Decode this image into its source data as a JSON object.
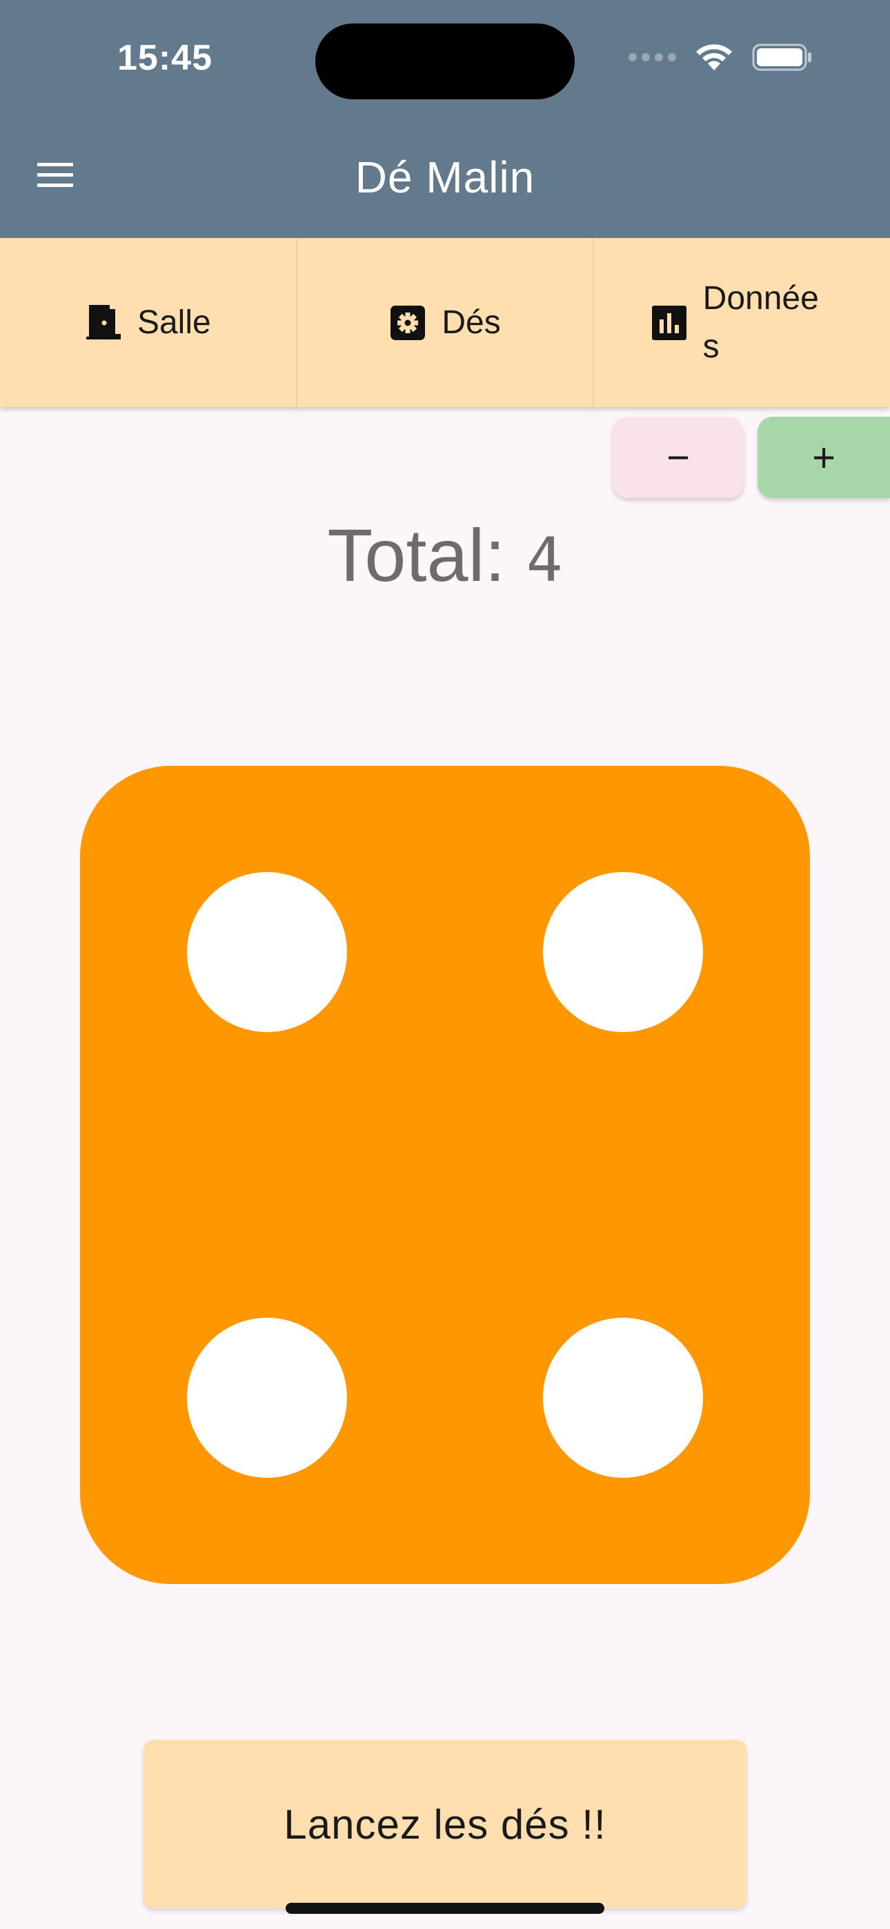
{
  "status_bar": {
    "time": "15:45"
  },
  "app_bar": {
    "title": "Dé Malin",
    "menu_icon": "menu-icon"
  },
  "tabs": [
    {
      "label": "Salle",
      "icon": "door-icon"
    },
    {
      "label": "Dés",
      "icon": "dice-icon"
    },
    {
      "label": "Données",
      "icon": "bar-chart-icon"
    }
  ],
  "stepper": {
    "minus_label": "−",
    "plus_label": "+"
  },
  "total": {
    "label": "Total:",
    "value": "4"
  },
  "die": {
    "face_value": 4,
    "color": "#FF9700",
    "pip_color": "#FFFFFF"
  },
  "roll_button": {
    "label": "Lancez les dés !!"
  },
  "colors": {
    "app_bar": "#637A8C",
    "tab_bar": "#FFDFAF",
    "background": "#FCF6FB",
    "minus_button": "#F9E3E9",
    "plus_button": "#A7D7A8",
    "total_text": "#706A6F"
  }
}
